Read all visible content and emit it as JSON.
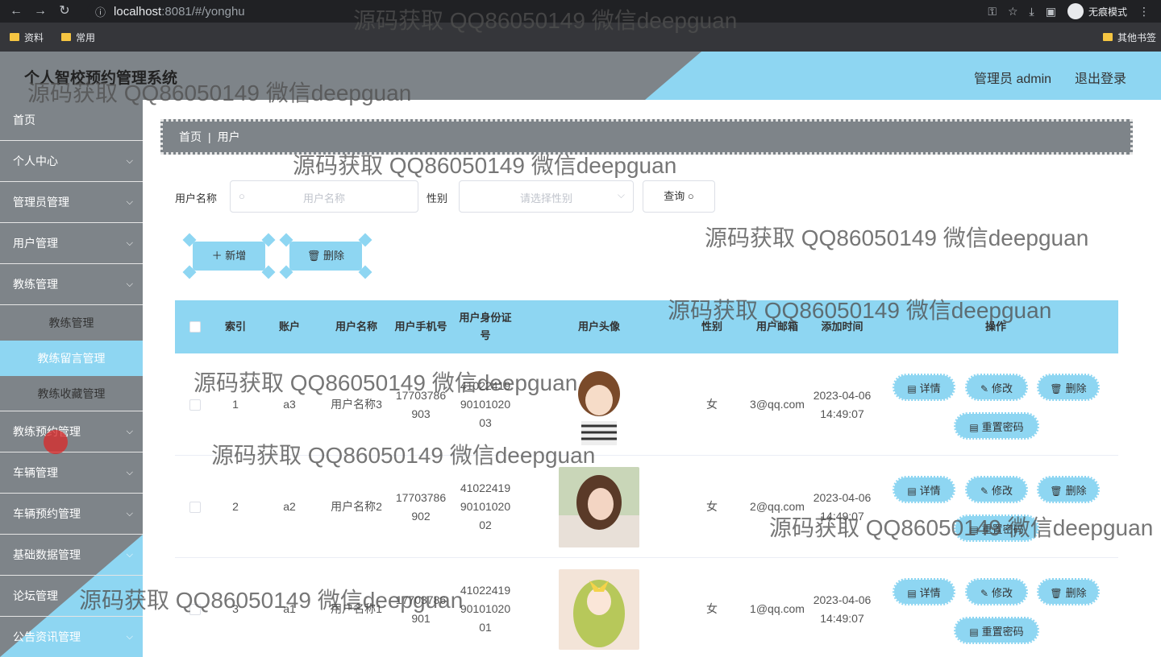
{
  "browser": {
    "url_host": "localhost",
    "url_rest": ":8081/#/yonghu",
    "incognito_label": "无痕模式",
    "bookmarks": [
      "资料",
      "常用"
    ],
    "other_bookmarks": "其他书签"
  },
  "header": {
    "title": "个人智校预约管理系统",
    "user": "管理员 admin",
    "logout": "退出登录"
  },
  "sidebar": {
    "items_top": [
      {
        "label": "首页",
        "chevron": false
      },
      {
        "label": "个人中心",
        "chevron": true
      },
      {
        "label": "管理员管理",
        "chevron": true
      },
      {
        "label": "用户管理",
        "chevron": true
      },
      {
        "label": "教练管理",
        "chevron": true
      }
    ],
    "sub_items": [
      {
        "label": "教练管理",
        "active": false
      },
      {
        "label": "教练留言管理",
        "active": true
      },
      {
        "label": "教练收藏管理",
        "active": false
      }
    ],
    "items_bottom": [
      {
        "label": "教练预约管理"
      },
      {
        "label": "车辆管理"
      },
      {
        "label": "车辆预约管理"
      },
      {
        "label": "基础数据管理"
      },
      {
        "label": "论坛管理"
      },
      {
        "label": "公告资讯管理"
      }
    ]
  },
  "breadcrumb": {
    "home": "首页",
    "current": "用户"
  },
  "search": {
    "name_label": "用户名称",
    "name_placeholder": "用户名称",
    "gender_label": "性别",
    "gender_placeholder": "请选择性别",
    "query_label": "查询"
  },
  "actions": {
    "add": "新增",
    "delete": "删除"
  },
  "table": {
    "headers": {
      "index": "索引",
      "account": "账户",
      "name": "用户名称",
      "phone": "用户手机号",
      "idcard": "用户身份证号",
      "avatar": "用户头像",
      "gender": "性别",
      "email": "用户邮箱",
      "added": "添加时间",
      "ops": "操作"
    },
    "rows": [
      {
        "index": "1",
        "account": "a3",
        "name": "用户名称3",
        "phone": "17703786903",
        "idcard": "410224199010102003",
        "gender": "女",
        "email": "3@qq.com",
        "added": "2023-04-06 14:49:07"
      },
      {
        "index": "2",
        "account": "a2",
        "name": "用户名称2",
        "phone": "17703786902",
        "idcard": "410224199010102002",
        "gender": "女",
        "email": "2@qq.com",
        "added": "2023-04-06 14:49:07"
      },
      {
        "index": "3",
        "account": "a1",
        "name": "用户名称1",
        "phone": "17703786901",
        "idcard": "410224199010102001",
        "gender": "女",
        "email": "1@qq.com",
        "added": "2023-04-06 14:49:07"
      }
    ],
    "op_labels": {
      "detail": "详情",
      "edit": "修改",
      "delete": "删除",
      "reset": "重置密码"
    }
  },
  "watermark_text": "源码获取 QQ86050149 微信deepguan",
  "colors": {
    "accent": "#8ed6f2",
    "gray": "#7e8489"
  }
}
